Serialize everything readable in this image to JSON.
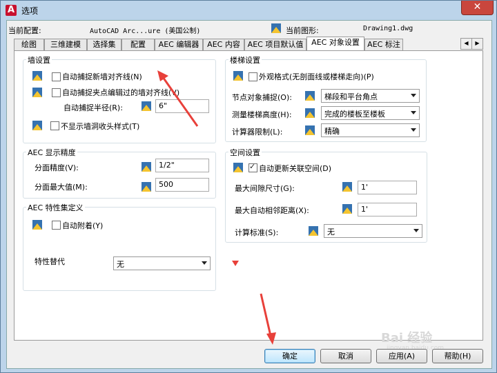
{
  "window": {
    "title": "选项",
    "app_icon": "A",
    "close_glyph": "✕"
  },
  "profile": {
    "label": "当前配置:",
    "value": "AutoCAD Arc...ure (美国公制)"
  },
  "drawing": {
    "label": "当前图形:",
    "value": "Drawing1.dwg"
  },
  "tabs": [
    "绘图",
    "三维建模",
    "选择集",
    "配置",
    "AEC 编辑器",
    "AEC 内容",
    "AEC 项目默认值",
    "AEC 对象设置",
    "AEC 标注"
  ],
  "active_tab": "AEC 对象设置",
  "tab_scroll": {
    "left": "◀",
    "right": "▶"
  },
  "wall": {
    "title": "墙设置",
    "autosnap_new": {
      "label": "自动捕捉新墙对齐线(N)",
      "checked": false
    },
    "autosnap_grip": {
      "label": "自动捕捉夹点编辑过的墙对齐线(V)",
      "checked": false
    },
    "radius": {
      "label": "自动捕捉半径(R):",
      "value": "6\""
    },
    "no_opening_endcap": {
      "label": "不显示墙洞收头样式(T)",
      "checked": false
    }
  },
  "precision": {
    "title": "AEC 显示精度",
    "facet_deviation": {
      "label": "分面精度(V):",
      "value": "1/2\""
    },
    "facet_max": {
      "label": "分面最大值(M):",
      "value": "500"
    }
  },
  "property_sets": {
    "title": "AEC 特性集定义",
    "auto_attach": {
      "label": "自动附着(Y)",
      "checked": false
    },
    "override": {
      "label": "特性替代",
      "value": "无"
    }
  },
  "stair": {
    "title": "楼梯设置",
    "appearance": {
      "label": "外观格式(无剖面线或楼梯走向)(P)",
      "checked": false
    },
    "node_snap": {
      "label": "节点对象捕捉(O):",
      "value": "梯段和平台角点"
    },
    "measure_height": {
      "label": "测量楼梯高度(H):",
      "value": "完成的楼板至楼板"
    },
    "calc_limits": {
      "label": "计算器限制(L):",
      "value": "精确"
    }
  },
  "space": {
    "title": "空间设置",
    "auto_update": {
      "label": "自动更新关联空间(D)",
      "checked": true
    },
    "max_gap": {
      "label": "最大间隙尺寸(G):",
      "value": "1'"
    },
    "max_auto_adj": {
      "label": "最大自动相邻距离(X):",
      "value": "1'"
    },
    "calc_standard": {
      "label": "计算标准(S):",
      "value": "无"
    }
  },
  "buttons": {
    "ok": "确定",
    "cancel": "取消",
    "apply": "应用(A)",
    "help": "帮助(H)"
  },
  "watermark": {
    "text": "Bai 经验",
    "sub": "jingyan.baidu.com"
  },
  "colors": {
    "accent": "#3c7fb1",
    "annotation_red": "#e8403a",
    "title_bar": "#bcd4ea"
  }
}
